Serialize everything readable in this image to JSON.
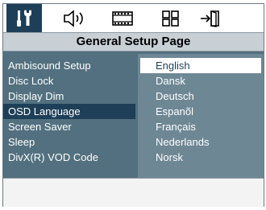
{
  "window": {
    "title": "General Setup Page"
  },
  "tabs": [
    {
      "icon": "setup-tools-icon",
      "active": true
    },
    {
      "icon": "speaker-audio-icon",
      "active": false
    },
    {
      "icon": "film-video-icon",
      "active": false
    },
    {
      "icon": "preferences-grid-icon",
      "active": false
    },
    {
      "icon": "exit-door-icon",
      "active": false
    }
  ],
  "menu": {
    "items": [
      {
        "label": "Ambisound Setup"
      },
      {
        "label": "Disc Lock"
      },
      {
        "label": "Display Dim"
      },
      {
        "label": "OSD Language",
        "selected": true
      },
      {
        "label": "Screen Saver"
      },
      {
        "label": "Sleep"
      },
      {
        "label": "DivX(R) VOD Code"
      }
    ]
  },
  "options": {
    "items": [
      {
        "label": "English",
        "highlighted": true
      },
      {
        "label": "Dansk"
      },
      {
        "label": "Deutsch"
      },
      {
        "label": "Espanõl"
      },
      {
        "label": "Français"
      },
      {
        "label": "Nederlands"
      },
      {
        "label": "Norsk"
      }
    ]
  },
  "colors": {
    "accent": "#1e3f57",
    "panel": "#52707f",
    "submenu": "#6e8794",
    "title_bar": "#c8cfd5"
  }
}
